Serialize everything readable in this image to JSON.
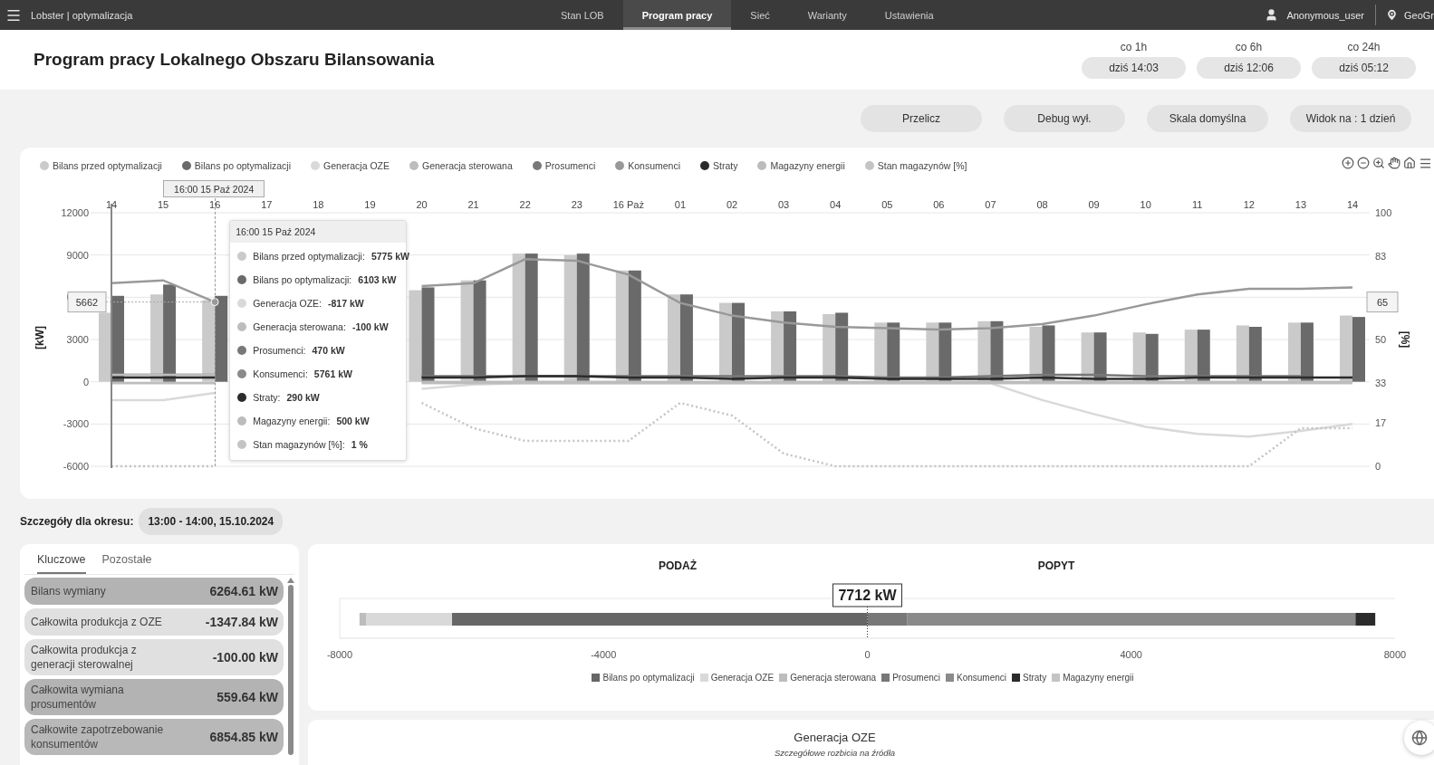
{
  "topbar": {
    "app_title": "Lobster | optymalizacja",
    "nav": [
      {
        "label": "Stan LOB",
        "selected": false
      },
      {
        "label": "Program pracy",
        "selected": true
      },
      {
        "label": "Sieć",
        "selected": false
      },
      {
        "label": "Warianty",
        "selected": false
      },
      {
        "label": "Ustawienia",
        "selected": false
      }
    ],
    "user": "Anonymous_user",
    "location": "GeoGr"
  },
  "header": {
    "title": "Program pracy Lokalnego Obszaru Bilansowania",
    "refresh": [
      {
        "interval": "co 1h",
        "time": "dziś 14:03"
      },
      {
        "interval": "co 6h",
        "time": "dziś 12:06"
      },
      {
        "interval": "co 24h",
        "time": "dziś 05:12"
      }
    ]
  },
  "actions": [
    "Przelicz",
    "Debug wył.",
    "Skala domyślna",
    "Widok na : 1 dzień"
  ],
  "main_chart": {
    "chart_data": {
      "type": "bar",
      "stacked": false,
      "ylabel": "[kW]",
      "y2label": "[%]",
      "categories": [
        "14",
        "15",
        "16",
        "17",
        "18",
        "19",
        "20",
        "21",
        "22",
        "23",
        "16 Paż",
        "01",
        "02",
        "03",
        "04",
        "05",
        "06",
        "07",
        "08",
        "09",
        "10",
        "11",
        "12",
        "13",
        "14"
      ],
      "ylim": [
        -6000,
        12000
      ],
      "yticks": [
        -6000,
        -3000,
        0,
        3000,
        6000,
        9000,
        12000
      ],
      "y2lim": [
        0,
        100
      ],
      "y2ticks": [
        0,
        17,
        33,
        50,
        83,
        100
      ],
      "series": [
        {
          "name": "Bilans przed optymalizacji",
          "color": "#cacaca",
          "type": "bar",
          "values": [
            4900,
            6200,
            5800,
            null,
            null,
            null,
            6500,
            7200,
            9100,
            9000,
            7900,
            6200,
            5600,
            5000,
            4800,
            4200,
            4200,
            4300,
            3900,
            3500,
            3500,
            3700,
            4000,
            4200,
            4700
          ]
        },
        {
          "name": "Bilans po optymalizacji",
          "color": "#6a6a6a",
          "type": "bar",
          "values": [
            6100,
            6900,
            6100,
            null,
            null,
            null,
            6700,
            7200,
            9100,
            9100,
            7900,
            6200,
            5600,
            5000,
            4900,
            4200,
            4200,
            4300,
            4000,
            3500,
            3400,
            3700,
            3900,
            4200,
            4600
          ]
        },
        {
          "name": "Generacja OZE",
          "color": "#d9d9d9",
          "type": "line",
          "values": [
            -1300,
            -1300,
            -800,
            null,
            null,
            null,
            -500,
            -200,
            -100,
            -100,
            -100,
            -100,
            -100,
            -100,
            -100,
            -100,
            -100,
            -100,
            -1300,
            -2300,
            -3200,
            -3700,
            -3900,
            -3500,
            -3000
          ]
        },
        {
          "name": "Generacja sterowana",
          "color": "#bdbdbd",
          "type": "line",
          "values": [
            -100,
            -100,
            -100,
            null,
            null,
            null,
            -100,
            -100,
            -100,
            -100,
            -100,
            -100,
            -100,
            -100,
            -100,
            -100,
            -100,
            -100,
            -100,
            -100,
            -100,
            -100,
            -100,
            -100,
            -100
          ]
        },
        {
          "name": "Prosumenci",
          "color": "#787878",
          "type": "line",
          "values": [
            500,
            500,
            500,
            null,
            null,
            null,
            400,
            400,
            400,
            400,
            400,
            400,
            400,
            400,
            400,
            300,
            300,
            400,
            500,
            500,
            400,
            400,
            400,
            400,
            null
          ]
        },
        {
          "name": "Konsumenci",
          "color": "#999999",
          "type": "line",
          "values": [
            7000,
            7200,
            5662,
            null,
            null,
            null,
            6800,
            7000,
            8700,
            8600,
            7600,
            5600,
            4700,
            4200,
            3900,
            3800,
            3700,
            3800,
            4100,
            4700,
            5500,
            6200,
            6600,
            6600,
            6700
          ]
        },
        {
          "name": "Straty",
          "color": "#2b2b2b",
          "type": "line",
          "values": [
            300,
            300,
            300,
            null,
            null,
            null,
            300,
            300,
            400,
            400,
            300,
            300,
            200,
            300,
            300,
            200,
            200,
            200,
            300,
            200,
            200,
            300,
            300,
            300,
            300
          ]
        },
        {
          "name": "Magazyny energii",
          "color": "#bcbcbc",
          "type": "line",
          "values": [
            500,
            500,
            500,
            null,
            null,
            null,
            0,
            0,
            0,
            0,
            0,
            0,
            0,
            0,
            0,
            0,
            0,
            0,
            0,
            0,
            0,
            0,
            0,
            0,
            0
          ]
        },
        {
          "name": "Stan magazynów [%]",
          "color": "#c4c4c4",
          "type": "line",
          "line_style": "dotted",
          "axis": "y2",
          "values": [
            0,
            0,
            0,
            null,
            null,
            null,
            25,
            15,
            10,
            10,
            10,
            25,
            20,
            5,
            0,
            0,
            0,
            0,
            0,
            0,
            0,
            0,
            0,
            15,
            15
          ]
        }
      ],
      "annotations": [
        {
          "x": "16",
          "y": 5662,
          "text": "5662"
        }
      ]
    },
    "crosshair": {
      "text": "16:00 15 Paź 2024"
    },
    "right_axis_label": "65",
    "tooltip": {
      "title": "16:00 15 Paź 2024",
      "rows": [
        {
          "label": "Bilans przed optymalizacji:",
          "value": "5775 kW",
          "color": "#cacaca"
        },
        {
          "label": "Bilans po optymalizacji:",
          "value": "6103 kW",
          "color": "#6a6a6a"
        },
        {
          "label": "Generacja OZE:",
          "value": "-817 kW",
          "color": "#d9d9d9"
        },
        {
          "label": "Generacja sterowana:",
          "value": "-100 kW",
          "color": "#bdbdbd"
        },
        {
          "label": "Prosumenci:",
          "value": "470 kW",
          "color": "#787878"
        },
        {
          "label": "Konsumenci:",
          "value": "5761 kW",
          "color": "#8a8a8a"
        },
        {
          "label": "Straty:",
          "value": "290 kW",
          "color": "#2b2b2b"
        },
        {
          "label": "Magazyny energii:",
          "value": "500 kW",
          "color": "#bcbcbc"
        },
        {
          "label": "Stan magazynów [%]:",
          "value": "1 %",
          "color": "#c4c4c4"
        }
      ]
    }
  },
  "details": {
    "label": "Szczegóły dla okresu:",
    "period": "13:00 - 14:00, 15.10.2024",
    "tabs": [
      {
        "label": "Kluczowe",
        "selected": true
      },
      {
        "label": "Pozostałe",
        "selected": false
      }
    ],
    "rows": [
      {
        "label": "Bilans wymiany",
        "value": "6264.61 kW",
        "color": "#b3b3b3"
      },
      {
        "label": "Całkowita produkcja z OZE",
        "value": "-1347.84 kW",
        "color": "#e0e0e0"
      },
      {
        "label": "Całkowita produkcja z generacji sterowalnej",
        "value": "-100.00 kW",
        "color": "#e0e0e0"
      },
      {
        "label": "Całkowita wymiana prosumentów",
        "value": "559.64 kW",
        "color": "#b3b3b3"
      },
      {
        "label": "Całkowite zapotrzebowanie konsumentów",
        "value": "6854.85 kW",
        "color": "#b8b8b8"
      }
    ]
  },
  "balance": {
    "headings": [
      "PODAŻ",
      "POPYT"
    ],
    "total_label": "7712 kW",
    "chart_data": {
      "type": "bar",
      "orientation": "horizontal",
      "stacked": true,
      "xlim": [
        -8000,
        8000
      ],
      "xticks": [
        -8000,
        -4000,
        0,
        4000,
        8000
      ],
      "series": [
        {
          "name": "Bilans po optymalizacji",
          "color": "#666666",
          "values": [
            -6300
          ]
        },
        {
          "name": "Generacja OZE",
          "color": "#d9d9d9",
          "values": [
            -1300
          ]
        },
        {
          "name": "Generacja sterowana",
          "color": "#bdbdbd",
          "values": [
            -100
          ]
        },
        {
          "name": "Prosumenci",
          "color": "#787878",
          "values": [
            600
          ]
        },
        {
          "name": "Konsumenci",
          "color": "#8a8a8a",
          "values": [
            6800
          ]
        },
        {
          "name": "Straty",
          "color": "#2b2b2b",
          "values": [
            300
          ]
        },
        {
          "name": "Magazyny energii",
          "color": "#c4c4c4",
          "values": [
            0
          ]
        }
      ]
    }
  },
  "source_card": {
    "title": "Generacja OZE",
    "subtitle": "Szczegółowe rozbicia na źródła"
  }
}
